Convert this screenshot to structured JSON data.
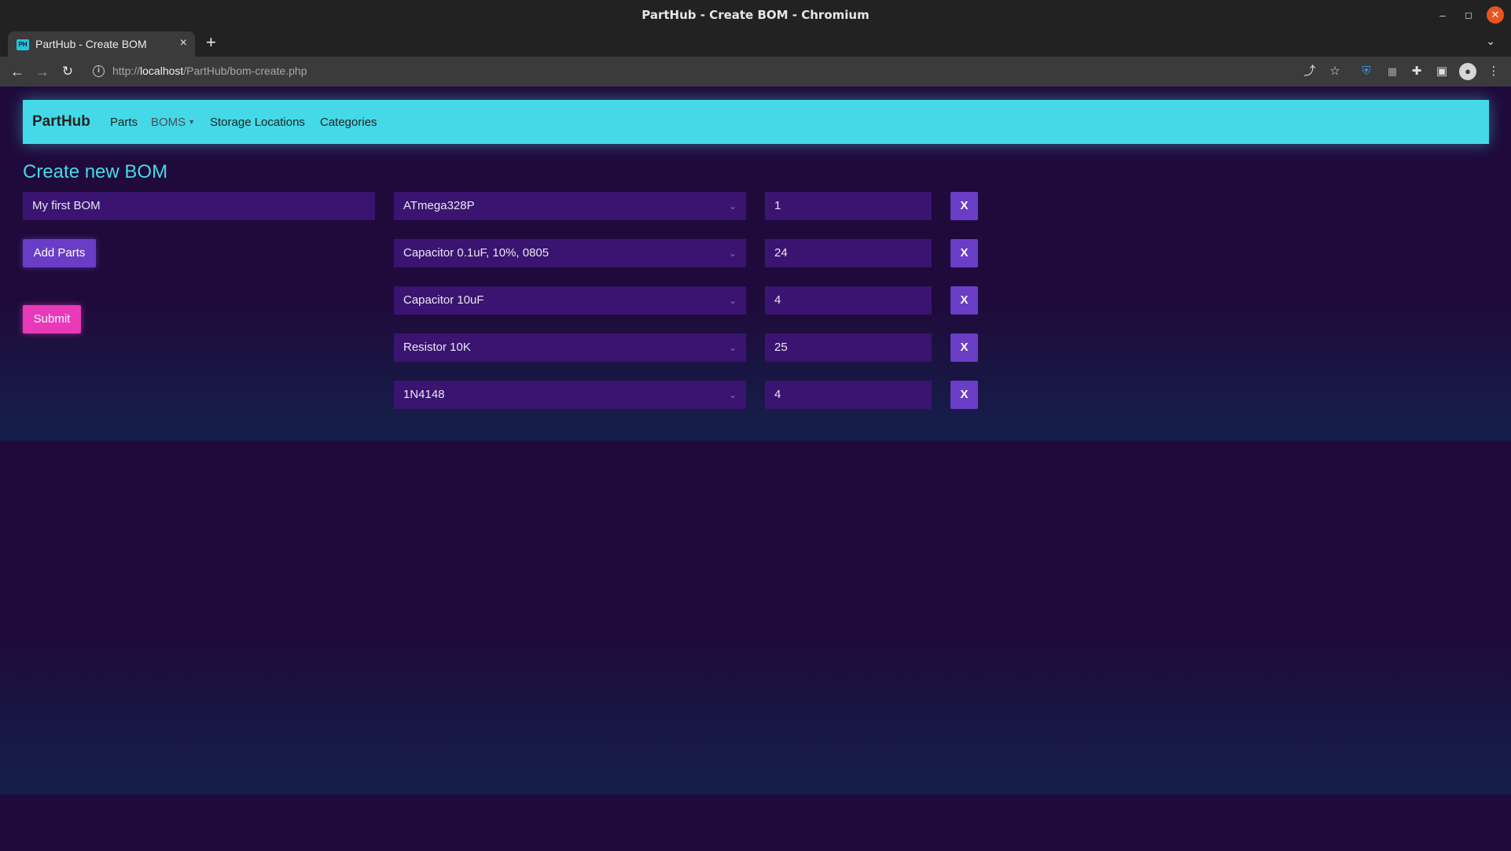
{
  "window": {
    "title": "PartHub - Create BOM - Chromium"
  },
  "tab": {
    "title": "PartHub - Create BOM",
    "favicon_text": "PH"
  },
  "address": {
    "scheme": "http://",
    "host": "localhost",
    "path": "/PartHub/bom-create.php"
  },
  "nav": {
    "brand": "PartHub",
    "links": {
      "parts": "Parts",
      "boms": "BOMS",
      "storage": "Storage Locations",
      "categories": "Categories"
    }
  },
  "page": {
    "title": "Create new BOM",
    "bom_name_value": "My first BOM",
    "add_parts_label": "Add Parts",
    "submit_label": "Submit",
    "remove_label": "X"
  },
  "parts": [
    {
      "part": "ATmega328P",
      "qty": "1"
    },
    {
      "part": "Capacitor 0.1uF, 10%, 0805",
      "qty": "24"
    },
    {
      "part": "Capacitor 10uF",
      "qty": "4"
    },
    {
      "part": "Resistor 10K",
      "qty": "25"
    },
    {
      "part": "1N4148",
      "qty": "4"
    }
  ],
  "colors": {
    "navbar": "#45d9e8",
    "background": "#1f0a3b",
    "field": "#3a1470",
    "primary_button": "#6a3dc6",
    "submit_button": "#e83ab8"
  }
}
